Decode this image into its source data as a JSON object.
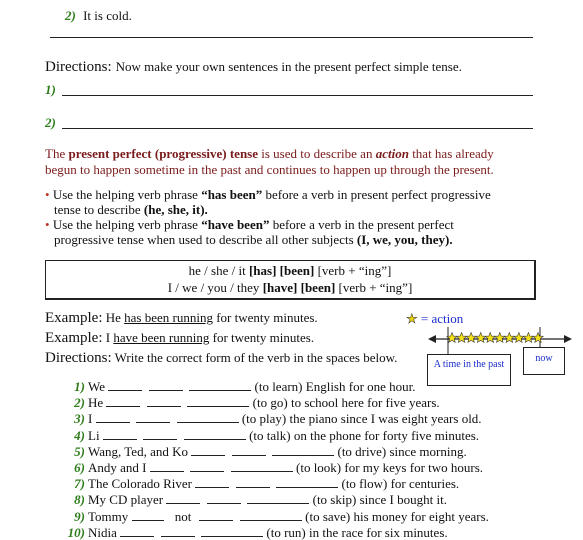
{
  "top_item": {
    "number": "2)",
    "text": "It is cold."
  },
  "directions1": {
    "label": "Directions:",
    "text": "Now make your own sentences in the present perfect simple tense.",
    "lines": [
      "1)",
      "2)"
    ]
  },
  "definition": {
    "part1": "The ",
    "bold1": "present perfect (progressive) tense",
    "part2": " is used to describe an ",
    "italic": "action",
    "part3": " that has already",
    "line2": "begun to happen sometime in the past and continues to happen up through the present."
  },
  "bullets": [
    {
      "pre": "Use the helping verb phrase ",
      "bold": "“has been”",
      "mid": " before a verb in present perfect progressive",
      "line2_pre": "tense to describe ",
      "line2_bold": "(he, she, it)."
    },
    {
      "pre": "Use the helping verb phrase ",
      "bold": "“have been”",
      "mid": " before a verb in the present perfect",
      "line2_pre": "progressive tense when used to describe all other subjects ",
      "line2_bold": "(I, we, you, they)."
    }
  ],
  "formula": {
    "row1": {
      "subject": "he / she / it ",
      "aux": "[has]",
      "been": "[been]",
      "verb": " [verb + “ing”]"
    },
    "row2": {
      "subject": "I / we / you / they ",
      "aux": "[have]",
      "been": "[been]",
      "verb": " [verb + “ing”]"
    }
  },
  "examples": [
    {
      "label": "Example:",
      "pre": "He ",
      "underlined": "has been running",
      "post": " for twenty minutes."
    },
    {
      "label": "Example:",
      "pre": "I ",
      "underlined": "have been running",
      "post": " for twenty minutes."
    }
  ],
  "directions2": {
    "label": "Directions:",
    "text": "Write the correct form of the verb in the spaces below."
  },
  "timeline": {
    "legend_star": "★",
    "legend_text": "= action",
    "star_count": 10,
    "past_label": "A time in the past",
    "now_label": "now"
  },
  "exercises": [
    {
      "number": "1)",
      "subject": "We",
      "not": "",
      "verb": "(to learn)",
      "rest": "English for one hour."
    },
    {
      "number": "2)",
      "subject": "He",
      "not": "",
      "verb": "(to go)",
      "rest": "to school here for five years."
    },
    {
      "number": "3)",
      "subject": "I",
      "not": "",
      "verb": "(to play)",
      "rest": "the piano since I was eight years old."
    },
    {
      "number": "4)",
      "subject": "Li",
      "not": "",
      "verb": "(to talk)",
      "rest": "on the phone for forty five minutes."
    },
    {
      "number": "5)",
      "subject": "Wang, Ted, and Ko",
      "not": "",
      "verb": "(to drive)",
      "rest": "since morning."
    },
    {
      "number": "6)",
      "subject": "Andy and I",
      "not": "",
      "verb": "(to look)",
      "rest": "for my keys for two hours."
    },
    {
      "number": "7)",
      "subject": "The Colorado River",
      "not": "",
      "verb": "(to flow)",
      "rest": "for centuries."
    },
    {
      "number": "8)",
      "subject": "My CD player",
      "not": "",
      "verb": "(to skip)",
      "rest": "since I bought it."
    },
    {
      "number": "9)",
      "subject": "Tommy",
      "not": "not",
      "verb": "(to save)",
      "rest": "his money for eight years."
    },
    {
      "number": "10)",
      "subject": "Nidia",
      "not": "",
      "verb": "(to run)",
      "rest": "in the race for six minutes."
    }
  ],
  "colors": {
    "number_green": "#2e7d1a",
    "definition_red": "#7a1b1b",
    "timeline_blue": "#1a2cc8",
    "star_yellow": "#f5e11a"
  }
}
